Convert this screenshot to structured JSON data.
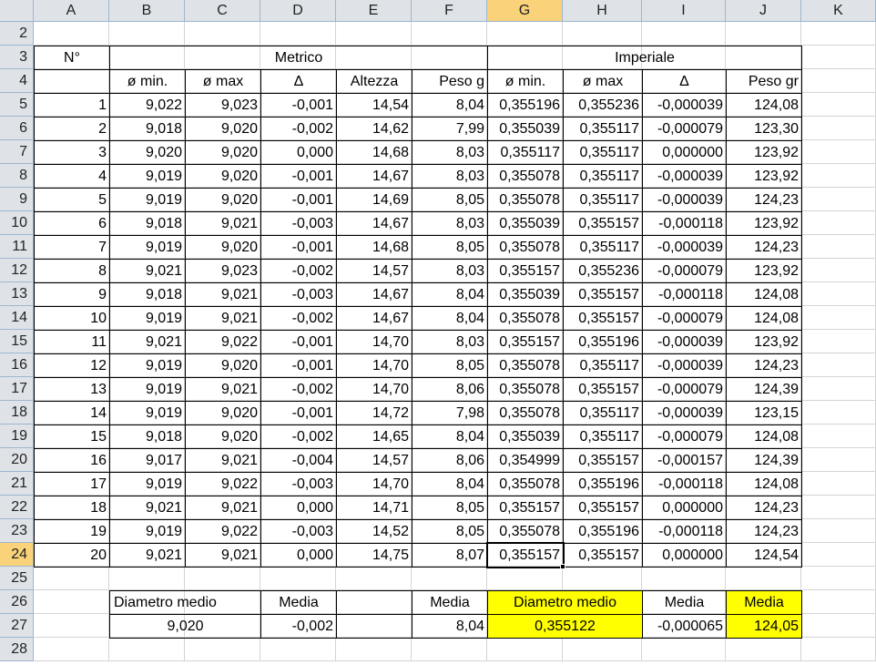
{
  "columns": [
    "A",
    "B",
    "C",
    "D",
    "E",
    "F",
    "G",
    "H",
    "I",
    "J",
    "K"
  ],
  "selected_column": "G",
  "selected_row": 24,
  "first_row": 2,
  "last_row": 28,
  "headers": {
    "n_label": "N°",
    "metrico": "Metrico",
    "imperiale": "Imperiale",
    "sub": [
      "ø min.",
      "ø max",
      "Δ",
      "Altezza",
      "Peso g",
      "ø min.",
      "ø max",
      "Δ",
      "Peso gr"
    ]
  },
  "rows": [
    [
      "1",
      "9,022",
      "9,023",
      "-0,001",
      "14,54",
      "8,04",
      "0,355196",
      "0,355236",
      "-0,000039",
      "124,08"
    ],
    [
      "2",
      "9,018",
      "9,020",
      "-0,002",
      "14,62",
      "7,99",
      "0,355039",
      "0,355117",
      "-0,000079",
      "123,30"
    ],
    [
      "3",
      "9,020",
      "9,020",
      "0,000",
      "14,68",
      "8,03",
      "0,355117",
      "0,355117",
      "0,000000",
      "123,92"
    ],
    [
      "4",
      "9,019",
      "9,020",
      "-0,001",
      "14,67",
      "8,03",
      "0,355078",
      "0,355117",
      "-0,000039",
      "123,92"
    ],
    [
      "5",
      "9,019",
      "9,020",
      "-0,001",
      "14,69",
      "8,05",
      "0,355078",
      "0,355117",
      "-0,000039",
      "124,23"
    ],
    [
      "6",
      "9,018",
      "9,021",
      "-0,003",
      "14,67",
      "8,03",
      "0,355039",
      "0,355157",
      "-0,000118",
      "123,92"
    ],
    [
      "7",
      "9,019",
      "9,020",
      "-0,001",
      "14,68",
      "8,05",
      "0,355078",
      "0,355117",
      "-0,000039",
      "124,23"
    ],
    [
      "8",
      "9,021",
      "9,023",
      "-0,002",
      "14,57",
      "8,03",
      "0,355157",
      "0,355236",
      "-0,000079",
      "123,92"
    ],
    [
      "9",
      "9,018",
      "9,021",
      "-0,003",
      "14,67",
      "8,04",
      "0,355039",
      "0,355157",
      "-0,000118",
      "124,08"
    ],
    [
      "10",
      "9,019",
      "9,021",
      "-0,002",
      "14,67",
      "8,04",
      "0,355078",
      "0,355157",
      "-0,000079",
      "124,08"
    ],
    [
      "11",
      "9,021",
      "9,022",
      "-0,001",
      "14,70",
      "8,03",
      "0,355157",
      "0,355196",
      "-0,000039",
      "123,92"
    ],
    [
      "12",
      "9,019",
      "9,020",
      "-0,001",
      "14,70",
      "8,05",
      "0,355078",
      "0,355117",
      "-0,000039",
      "124,23"
    ],
    [
      "13",
      "9,019",
      "9,021",
      "-0,002",
      "14,70",
      "8,06",
      "0,355078",
      "0,355157",
      "-0,000079",
      "124,39"
    ],
    [
      "14",
      "9,019",
      "9,020",
      "-0,001",
      "14,72",
      "7,98",
      "0,355078",
      "0,355117",
      "-0,000039",
      "123,15"
    ],
    [
      "15",
      "9,018",
      "9,020",
      "-0,002",
      "14,65",
      "8,04",
      "0,355039",
      "0,355117",
      "-0,000079",
      "124,08"
    ],
    [
      "16",
      "9,017",
      "9,021",
      "-0,004",
      "14,57",
      "8,06",
      "0,354999",
      "0,355157",
      "-0,000157",
      "124,39"
    ],
    [
      "17",
      "9,019",
      "9,022",
      "-0,003",
      "14,70",
      "8,04",
      "0,355078",
      "0,355196",
      "-0,000118",
      "124,08"
    ],
    [
      "18",
      "9,021",
      "9,021",
      "0,000",
      "14,71",
      "8,05",
      "0,355157",
      "0,355157",
      "0,000000",
      "124,23"
    ],
    [
      "19",
      "9,019",
      "9,022",
      "-0,003",
      "14,52",
      "8,05",
      "0,355078",
      "0,355196",
      "-0,000118",
      "124,23"
    ],
    [
      "20",
      "9,021",
      "9,021",
      "0,000",
      "14,75",
      "8,07",
      "0,355157",
      "0,355157",
      "0,000000",
      "124,54"
    ]
  ],
  "summary": {
    "diametro_medio_label": "Diametro medio",
    "media_label_d": "Media",
    "media_label_f": "Media",
    "diametro_medio_label_g": "Diametro medio",
    "media_label_i": "Media",
    "media_label_j": "Media",
    "diametro_medio_value": "9,020",
    "media_d_value": "-0,002",
    "media_f_value": "8,04",
    "diametro_medio_g_value": "0,355122",
    "media_i_value": "-0,000065",
    "media_j_value": "124,05"
  },
  "colors": {
    "highlight": "#ffff00",
    "selection_header": "#f9d27a",
    "header_bg": "#dfe3e8"
  }
}
